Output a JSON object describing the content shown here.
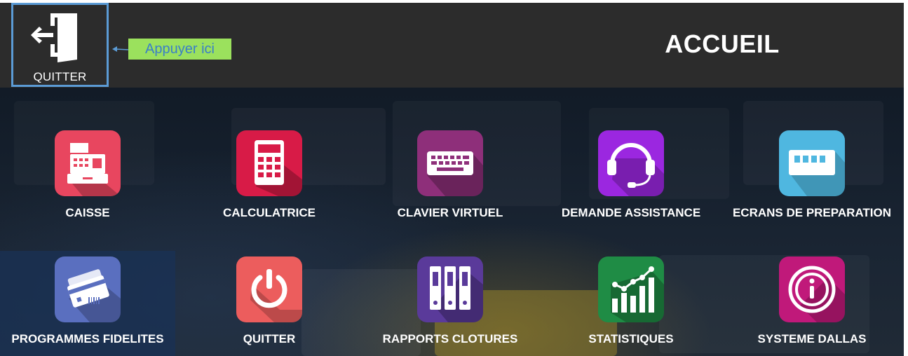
{
  "header": {
    "quit_label": "QUITTER",
    "callout_text": "Appuyer ici",
    "title": "ACCUEIL"
  },
  "tiles": [
    {
      "label": "CAISSE",
      "icon": "cash-register-icon",
      "color": "#e8465f"
    },
    {
      "label": "CALCULATRICE",
      "icon": "calculator-icon",
      "color": "#d81b47"
    },
    {
      "label": "CLAVIER VIRTUEL",
      "icon": "keyboard-icon",
      "color": "#8e2f7a"
    },
    {
      "label": "DEMANDE ASSISTANCE",
      "icon": "headset-icon",
      "color": "#9b27e0"
    },
    {
      "label": "ECRANS DE PREPARATION",
      "icon": "display-screen-icon",
      "color": "#4fb7e0"
    },
    {
      "label": "PROGRAMMES FIDELITES",
      "icon": "loyalty-cards-icon",
      "color": "#5a6fbf"
    },
    {
      "label": "QUITTER",
      "icon": "power-icon",
      "color": "#ec5d5d"
    },
    {
      "label": "RAPPORTS CLOTURES",
      "icon": "binders-icon",
      "color": "#5a3a9a"
    },
    {
      "label": "STATISTIQUES",
      "icon": "statistics-chart-icon",
      "color": "#1f8c45"
    },
    {
      "label": "SYSTEME DALLAS",
      "icon": "info-icon",
      "color": "#c0197a"
    }
  ]
}
